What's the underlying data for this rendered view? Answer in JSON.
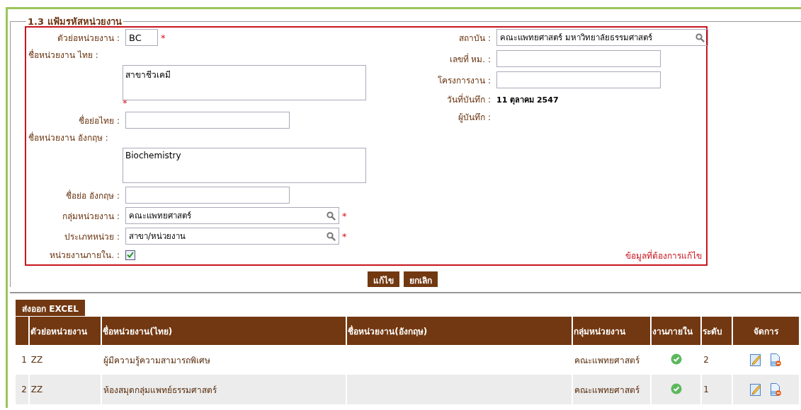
{
  "section": {
    "title": "1.3 แฟ้มรหัสหน่วยงาน"
  },
  "form": {
    "left": [
      {
        "kind": "short",
        "label": "ตัวย่อหน่วยงาน :",
        "value": "BC",
        "required_mark": "*"
      },
      {
        "kind": "textarea",
        "label": "ชื่อหน่วยงาน ไทย :",
        "value": "สาขาชีวเคมี",
        "required_mark": "*"
      },
      {
        "kind": "text",
        "label": "ชื่อย่อไทย :"
      },
      {
        "kind": "textarea",
        "label": "ชื่อหน่วยงาน อังกฤษ :",
        "value": "Biochemistry"
      },
      {
        "kind": "text",
        "label": "ชื่อย่อ อังกฤษ :"
      },
      {
        "kind": "lookup",
        "label": "กลุ่มหน่วยงาน :",
        "value": "คณะแพทยศาสตร์",
        "required_mark": "*"
      },
      {
        "kind": "lookup",
        "label": "ประเภทหน่วย :",
        "value": "สาขา/หน่วยงาน",
        "required_mark": "*"
      },
      {
        "kind": "checkbox",
        "label": "หน่วยงานภายใน. :",
        "checked": true
      }
    ],
    "right": [
      {
        "kind": "widelookup",
        "label": "สถาบัน :",
        "value": "คณะแพทยศาสตร์ มหาวิทยาลัยธรรมศาสตร์"
      },
      {
        "kind": "text",
        "label": "เลขที่ หม. :"
      },
      {
        "kind": "text",
        "label": "โครงการงาน :"
      },
      {
        "kind": "static",
        "label": "วันที่บันทึก :",
        "value": "11 ตุลาคม 2547"
      },
      {
        "kind": "static",
        "label": "ผู้บันทึก :"
      }
    ],
    "note": "ข้อมูลที่ต้องการแก้ไข"
  },
  "buttons": [
    "แก้ไข",
    "ยกเลิก"
  ],
  "export_button": "ส่งออก EXCEL",
  "table": {
    "columns": [
      "",
      "ตัวย่อหน่วยงาน",
      "ชื่อหน่วยงาน(ไทย)",
      "ชื่อหน่วยงาน(อังกฤษ)",
      "กลุ่มหน่วยงาน",
      "งานภายใน",
      "ระดับ",
      "จัดการ"
    ],
    "rows": [
      {
        "number": "1",
        "code": "ZZ",
        "name_th": "ผู้มีความรู้ความสามารถพิเศษ",
        "group": "คณะแพทยศาสตร์",
        "internal": true,
        "level": "2"
      },
      {
        "number": "2",
        "code": "ZZ",
        "name_th": "ห้องสมุดกลุ่มแพทย์ธรรมศาสตร์",
        "group": "คณะแพทยศาสตร์",
        "internal": true,
        "level": "1"
      }
    ]
  }
}
